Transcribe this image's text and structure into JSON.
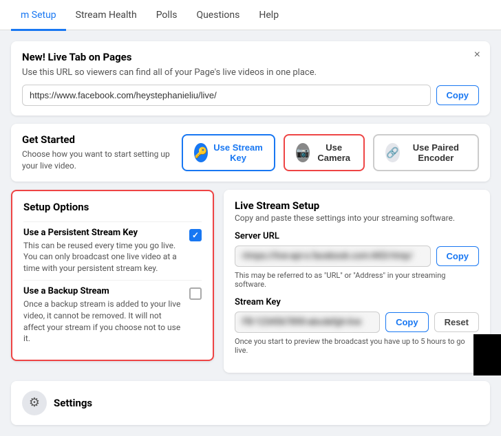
{
  "nav": {
    "items": [
      {
        "label": "m Setup",
        "active": true
      },
      {
        "label": "Stream Health",
        "active": false
      },
      {
        "label": "Polls",
        "active": false
      },
      {
        "label": "Questions",
        "active": false
      },
      {
        "label": "Help",
        "active": false
      }
    ]
  },
  "banner": {
    "title": "New! Live Tab on Pages",
    "desc": "Use this URL so viewers can find all of your Page's live videos in one place.",
    "url": "https://www.facebook.com/heystephanieliu/live/",
    "copy_label": "Copy"
  },
  "get_started": {
    "title": "Get Started",
    "desc": "Choose how you want to start setting up your live video.",
    "modes": [
      {
        "label": "Use Stream Key",
        "icon": "🔑",
        "icon_style": "blue-bg",
        "border": "blue-border"
      },
      {
        "label": "Use Camera",
        "icon": "📷",
        "icon_style": "gray-bg",
        "border": "red-border"
      },
      {
        "label": "Use Paired Encoder",
        "icon": "🔗",
        "icon_style": "light-bg",
        "border": ""
      }
    ]
  },
  "setup_options": {
    "title": "Setup Options",
    "options": [
      {
        "title": "Use a Persistent Stream Key",
        "desc": "This can be reused every time you go live. You can only broadcast one live video at a time with your persistent stream key.",
        "checked": true
      },
      {
        "title": "Use a Backup Stream",
        "desc": "Once a backup stream is added to your live video, it cannot be removed. It will not affect your stream if you choose not to use it.",
        "checked": false
      }
    ]
  },
  "live_stream_setup": {
    "title": "Live Stream Setup",
    "desc": "Copy and paste these settings into your streaming software.",
    "server_url_label": "Server URL",
    "server_url_placeholder": "rtmps://live-api-s.facebook.com:443/rtmp/",
    "server_url_note": "This may be referred to as \"URL\" or \"Address\" in your streaming software.",
    "stream_key_label": "Stream Key",
    "stream_key_placeholder": "FB-1234567890-abcdefgh-live",
    "stream_key_note": "Once you start to preview the broadcast you have up to 5 hours to go live.",
    "copy_label": "Copy",
    "reset_label": "Reset"
  },
  "settings": {
    "label": "Settings"
  }
}
